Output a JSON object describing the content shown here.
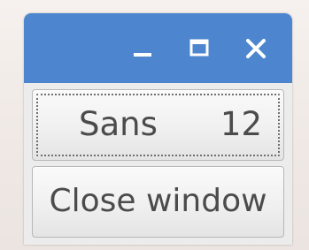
{
  "window": {
    "titlebar_color": "#4d86cf",
    "controls": {
      "minimize_icon": "minimize-icon",
      "maximize_icon": "maximize-icon",
      "close_icon": "close-icon"
    }
  },
  "font_button": {
    "font_name": "Sans",
    "font_size": "12"
  },
  "close_button": {
    "label": "Close window"
  }
}
